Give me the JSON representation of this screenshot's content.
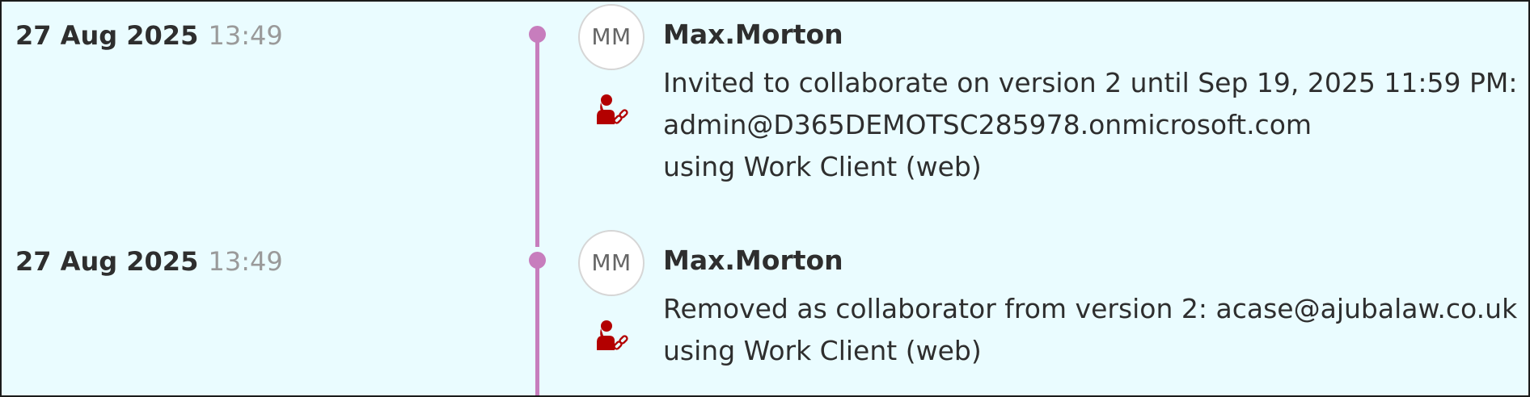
{
  "colors": {
    "background": "#eafcff",
    "timeline": "#c77dbd",
    "icon": "#b30000",
    "time_text": "#9a9a9a"
  },
  "entries": [
    {
      "date": "27 Aug 2025",
      "time": "13:49",
      "avatar_initials": "MM",
      "user": "Max.Morton",
      "icon": "user-link-icon",
      "lines": [
        "Invited to collaborate on version 2 until Sep 19, 2025 11:59 PM:",
        "admin@D365DEMOTSC285978.onmicrosoft.com",
        "using Work Client (web)"
      ]
    },
    {
      "date": "27 Aug 2025",
      "time": "13:49",
      "avatar_initials": "MM",
      "user": "Max.Morton",
      "icon": "user-link-icon",
      "lines": [
        "Removed as collaborator from version 2: acase@ajubalaw.co.uk",
        "using Work Client (web)"
      ]
    }
  ]
}
